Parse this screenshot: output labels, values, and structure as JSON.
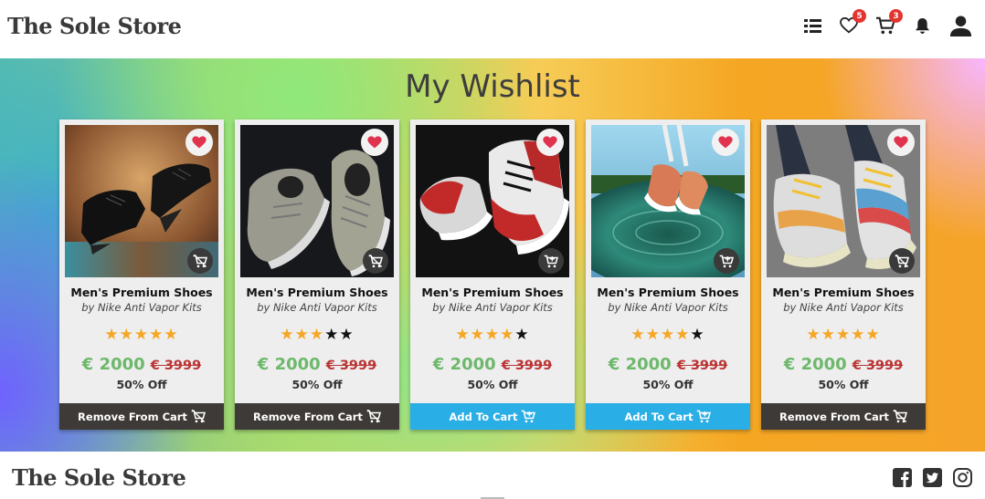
{
  "navbar": {
    "brand": "The Sole Store",
    "wishlist_count": "5",
    "cart_count": "3"
  },
  "hero": {
    "title": "My Wishlist"
  },
  "colors": {
    "price_green": "#6db86b",
    "old_price_red": "#b33333",
    "star_gold": "#f5a623",
    "remove_button": "#3e3a37",
    "add_button": "#2aaee6",
    "badge_red": "#e3342f"
  },
  "products": [
    {
      "name": "Men's Premium Shoes",
      "brand": "by Nike Anti Vapor Kits",
      "rating": 5,
      "price": "€ 2000",
      "old_price": "€ 3999",
      "discount": "50% Off",
      "action": "Remove From Cart",
      "action_type": "remove",
      "cart_icon": "cart-remove-icon"
    },
    {
      "name": "Men's Premium Shoes",
      "brand": "by Nike Anti Vapor Kits",
      "rating": 3,
      "price": "€ 2000",
      "old_price": "€ 3999",
      "discount": "50% Off",
      "action": "Remove From Cart",
      "action_type": "remove",
      "cart_icon": "cart-remove-icon"
    },
    {
      "name": "Men's Premium Shoes",
      "brand": "by Nike Anti Vapor Kits",
      "rating": 4,
      "price": "€ 2000",
      "old_price": "€ 3999",
      "discount": "50% Off",
      "action": "Add To Cart",
      "action_type": "add",
      "cart_icon": "cart-add-icon"
    },
    {
      "name": "Men's Premium Shoes",
      "brand": "by Nike Anti Vapor Kits",
      "rating": 4,
      "price": "€ 2000",
      "old_price": "€ 3999",
      "discount": "50% Off",
      "action": "Add To Cart",
      "action_type": "add",
      "cart_icon": "cart-add-icon"
    },
    {
      "name": "Men's Premium Shoes",
      "brand": "by Nike Anti Vapor Kits",
      "rating": 5,
      "price": "€ 2000",
      "old_price": "€ 3999",
      "discount": "50% Off",
      "action": "Remove From Cart",
      "action_type": "remove",
      "cart_icon": "cart-remove-icon"
    }
  ],
  "footer": {
    "brand": "The Sole Store",
    "social": [
      "facebook-icon",
      "twitter-icon",
      "instagram-icon"
    ]
  }
}
